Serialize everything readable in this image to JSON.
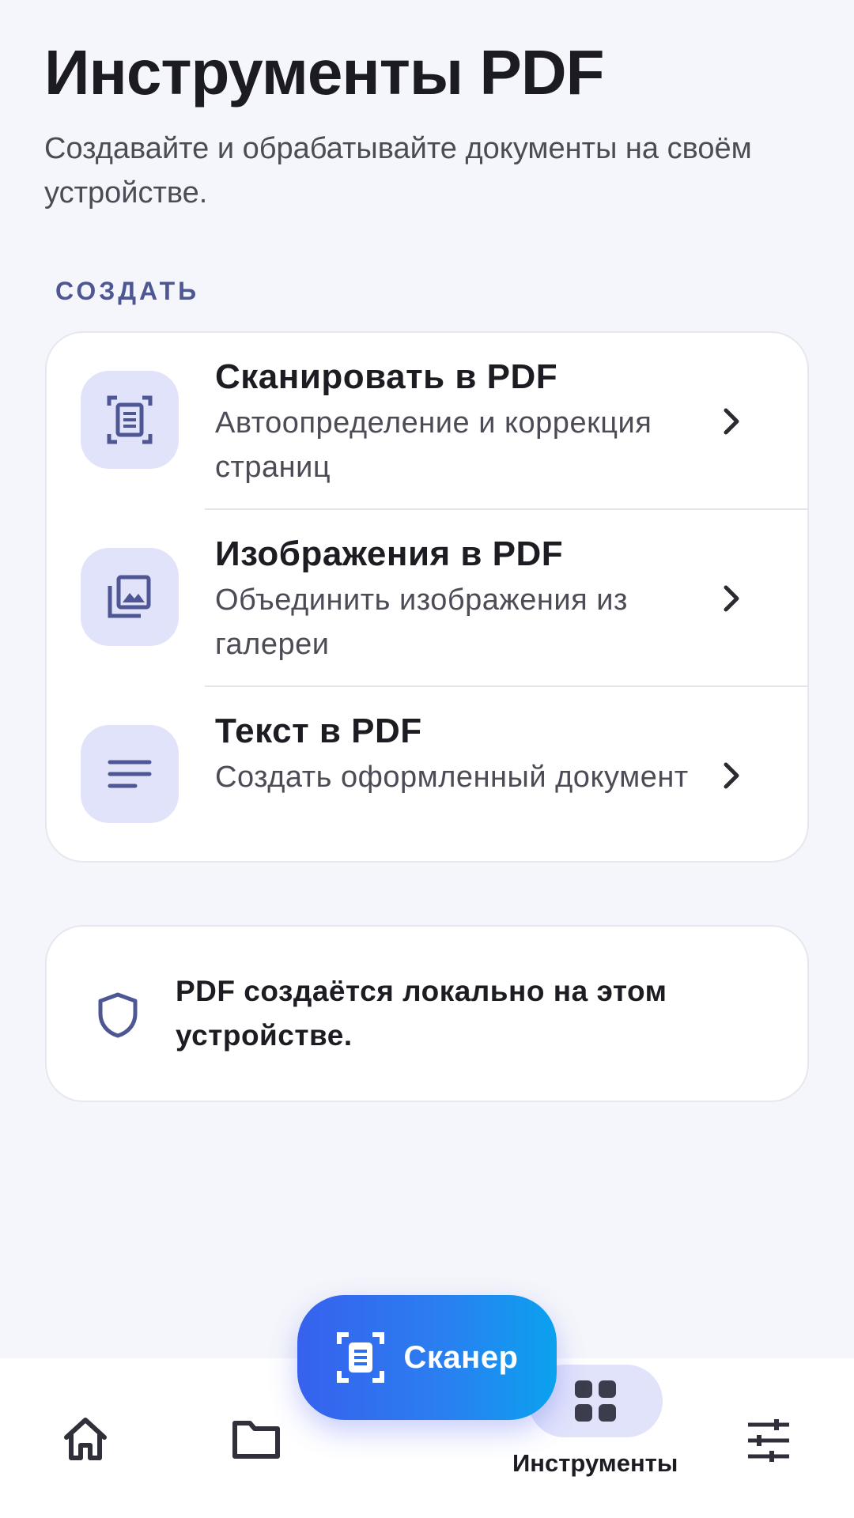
{
  "header": {
    "title": "Инструменты PDF",
    "subtitle": "Создавайте и обрабатывайте документы на своём устройстве."
  },
  "section": {
    "label": "СОЗДАТЬ"
  },
  "tools": [
    {
      "title": "Сканировать в PDF",
      "description": "Автоопределение и коррекция страниц",
      "icon": "document-scanner-icon"
    },
    {
      "title": "Изображения в PDF",
      "description": "Объединить изображения из галереи",
      "icon": "photo-library-icon"
    },
    {
      "title": "Текст в PDF",
      "description": "Создать оформленный документ",
      "icon": "text-lines-icon"
    }
  ],
  "info": {
    "text": "PDF создаётся локально на этом устройстве.",
    "icon": "shield-icon"
  },
  "fab": {
    "label": "Сканер",
    "icon": "document-scanner-icon"
  },
  "nav": {
    "items": [
      {
        "icon": "home-icon"
      },
      {
        "icon": "folder-icon"
      },
      {
        "icon": "grid-icon",
        "label": "Инструменты",
        "active": true
      },
      {
        "icon": "sliders-icon"
      }
    ]
  },
  "colors": {
    "background": "#f5f6fb",
    "accent": "#4e5793",
    "icon_tile": "#e1e3fb",
    "fab_gradient_start": "#3661ee",
    "fab_gradient_end": "#0aa2ef"
  }
}
